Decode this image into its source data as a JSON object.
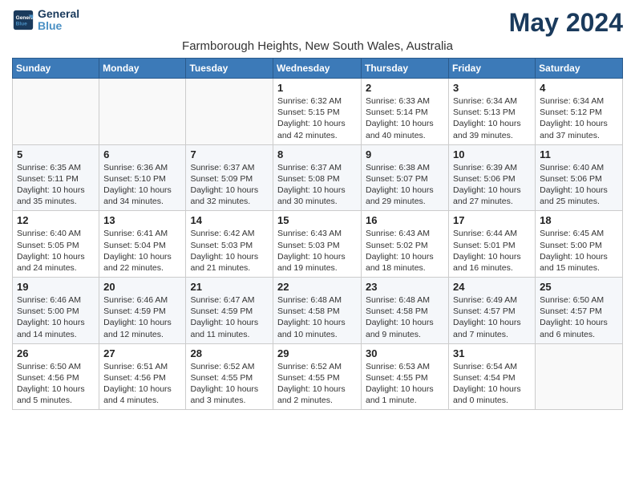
{
  "logo": {
    "line1": "General",
    "line2": "Blue"
  },
  "title": "May 2024",
  "subtitle": "Farmborough Heights, New South Wales, Australia",
  "days_header": [
    "Sunday",
    "Monday",
    "Tuesday",
    "Wednesday",
    "Thursday",
    "Friday",
    "Saturday"
  ],
  "weeks": [
    {
      "cells": [
        {
          "day": "",
          "content": ""
        },
        {
          "day": "",
          "content": ""
        },
        {
          "day": "",
          "content": ""
        },
        {
          "day": "1",
          "content": "Sunrise: 6:32 AM\nSunset: 5:15 PM\nDaylight: 10 hours and 42 minutes."
        },
        {
          "day": "2",
          "content": "Sunrise: 6:33 AM\nSunset: 5:14 PM\nDaylight: 10 hours and 40 minutes."
        },
        {
          "day": "3",
          "content": "Sunrise: 6:34 AM\nSunset: 5:13 PM\nDaylight: 10 hours and 39 minutes."
        },
        {
          "day": "4",
          "content": "Sunrise: 6:34 AM\nSunset: 5:12 PM\nDaylight: 10 hours and 37 minutes."
        }
      ]
    },
    {
      "cells": [
        {
          "day": "5",
          "content": "Sunrise: 6:35 AM\nSunset: 5:11 PM\nDaylight: 10 hours and 35 minutes."
        },
        {
          "day": "6",
          "content": "Sunrise: 6:36 AM\nSunset: 5:10 PM\nDaylight: 10 hours and 34 minutes."
        },
        {
          "day": "7",
          "content": "Sunrise: 6:37 AM\nSunset: 5:09 PM\nDaylight: 10 hours and 32 minutes."
        },
        {
          "day": "8",
          "content": "Sunrise: 6:37 AM\nSunset: 5:08 PM\nDaylight: 10 hours and 30 minutes."
        },
        {
          "day": "9",
          "content": "Sunrise: 6:38 AM\nSunset: 5:07 PM\nDaylight: 10 hours and 29 minutes."
        },
        {
          "day": "10",
          "content": "Sunrise: 6:39 AM\nSunset: 5:06 PM\nDaylight: 10 hours and 27 minutes."
        },
        {
          "day": "11",
          "content": "Sunrise: 6:40 AM\nSunset: 5:06 PM\nDaylight: 10 hours and 25 minutes."
        }
      ]
    },
    {
      "cells": [
        {
          "day": "12",
          "content": "Sunrise: 6:40 AM\nSunset: 5:05 PM\nDaylight: 10 hours and 24 minutes."
        },
        {
          "day": "13",
          "content": "Sunrise: 6:41 AM\nSunset: 5:04 PM\nDaylight: 10 hours and 22 minutes."
        },
        {
          "day": "14",
          "content": "Sunrise: 6:42 AM\nSunset: 5:03 PM\nDaylight: 10 hours and 21 minutes."
        },
        {
          "day": "15",
          "content": "Sunrise: 6:43 AM\nSunset: 5:03 PM\nDaylight: 10 hours and 19 minutes."
        },
        {
          "day": "16",
          "content": "Sunrise: 6:43 AM\nSunset: 5:02 PM\nDaylight: 10 hours and 18 minutes."
        },
        {
          "day": "17",
          "content": "Sunrise: 6:44 AM\nSunset: 5:01 PM\nDaylight: 10 hours and 16 minutes."
        },
        {
          "day": "18",
          "content": "Sunrise: 6:45 AM\nSunset: 5:00 PM\nDaylight: 10 hours and 15 minutes."
        }
      ]
    },
    {
      "cells": [
        {
          "day": "19",
          "content": "Sunrise: 6:46 AM\nSunset: 5:00 PM\nDaylight: 10 hours and 14 minutes."
        },
        {
          "day": "20",
          "content": "Sunrise: 6:46 AM\nSunset: 4:59 PM\nDaylight: 10 hours and 12 minutes."
        },
        {
          "day": "21",
          "content": "Sunrise: 6:47 AM\nSunset: 4:59 PM\nDaylight: 10 hours and 11 minutes."
        },
        {
          "day": "22",
          "content": "Sunrise: 6:48 AM\nSunset: 4:58 PM\nDaylight: 10 hours and 10 minutes."
        },
        {
          "day": "23",
          "content": "Sunrise: 6:48 AM\nSunset: 4:58 PM\nDaylight: 10 hours and 9 minutes."
        },
        {
          "day": "24",
          "content": "Sunrise: 6:49 AM\nSunset: 4:57 PM\nDaylight: 10 hours and 7 minutes."
        },
        {
          "day": "25",
          "content": "Sunrise: 6:50 AM\nSunset: 4:57 PM\nDaylight: 10 hours and 6 minutes."
        }
      ]
    },
    {
      "cells": [
        {
          "day": "26",
          "content": "Sunrise: 6:50 AM\nSunset: 4:56 PM\nDaylight: 10 hours and 5 minutes."
        },
        {
          "day": "27",
          "content": "Sunrise: 6:51 AM\nSunset: 4:56 PM\nDaylight: 10 hours and 4 minutes."
        },
        {
          "day": "28",
          "content": "Sunrise: 6:52 AM\nSunset: 4:55 PM\nDaylight: 10 hours and 3 minutes."
        },
        {
          "day": "29",
          "content": "Sunrise: 6:52 AM\nSunset: 4:55 PM\nDaylight: 10 hours and 2 minutes."
        },
        {
          "day": "30",
          "content": "Sunrise: 6:53 AM\nSunset: 4:55 PM\nDaylight: 10 hours and 1 minute."
        },
        {
          "day": "31",
          "content": "Sunrise: 6:54 AM\nSunset: 4:54 PM\nDaylight: 10 hours and 0 minutes."
        },
        {
          "day": "",
          "content": ""
        }
      ]
    }
  ]
}
